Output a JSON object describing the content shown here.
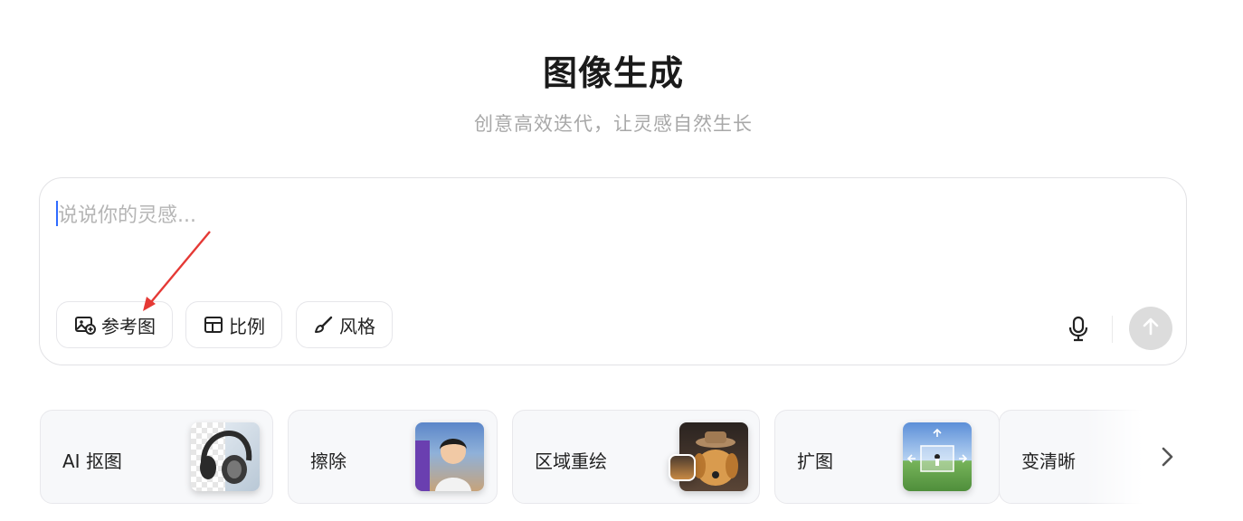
{
  "header": {
    "title": "图像生成",
    "subtitle": "创意高效迭代，让灵感自然生长"
  },
  "composer": {
    "placeholder": "说说你的灵感...",
    "value": "",
    "tools": [
      {
        "label": "参考图",
        "icon": "image-add-icon"
      },
      {
        "label": "比例",
        "icon": "aspect-ratio-icon"
      },
      {
        "label": "风格",
        "icon": "brush-icon"
      }
    ],
    "mic_icon": "microphone-icon",
    "send_icon": "send-arrow-up-icon"
  },
  "features": [
    {
      "label": "AI 抠图",
      "thumb": "headphones-cutout"
    },
    {
      "label": "擦除",
      "thumb": "girl-portrait"
    },
    {
      "label": "区域重绘",
      "thumb": "dog-with-hat"
    },
    {
      "label": "扩图",
      "thumb": "landscape-expand"
    },
    {
      "label": "变清晰",
      "thumb": "sharpen"
    }
  ],
  "carousel": {
    "next_icon": "chevron-right-icon"
  },
  "annotation": {
    "arrow_color": "#e53935"
  },
  "colors": {
    "accent": "#2f6bff",
    "send_disabled": "#dcdcdc"
  }
}
